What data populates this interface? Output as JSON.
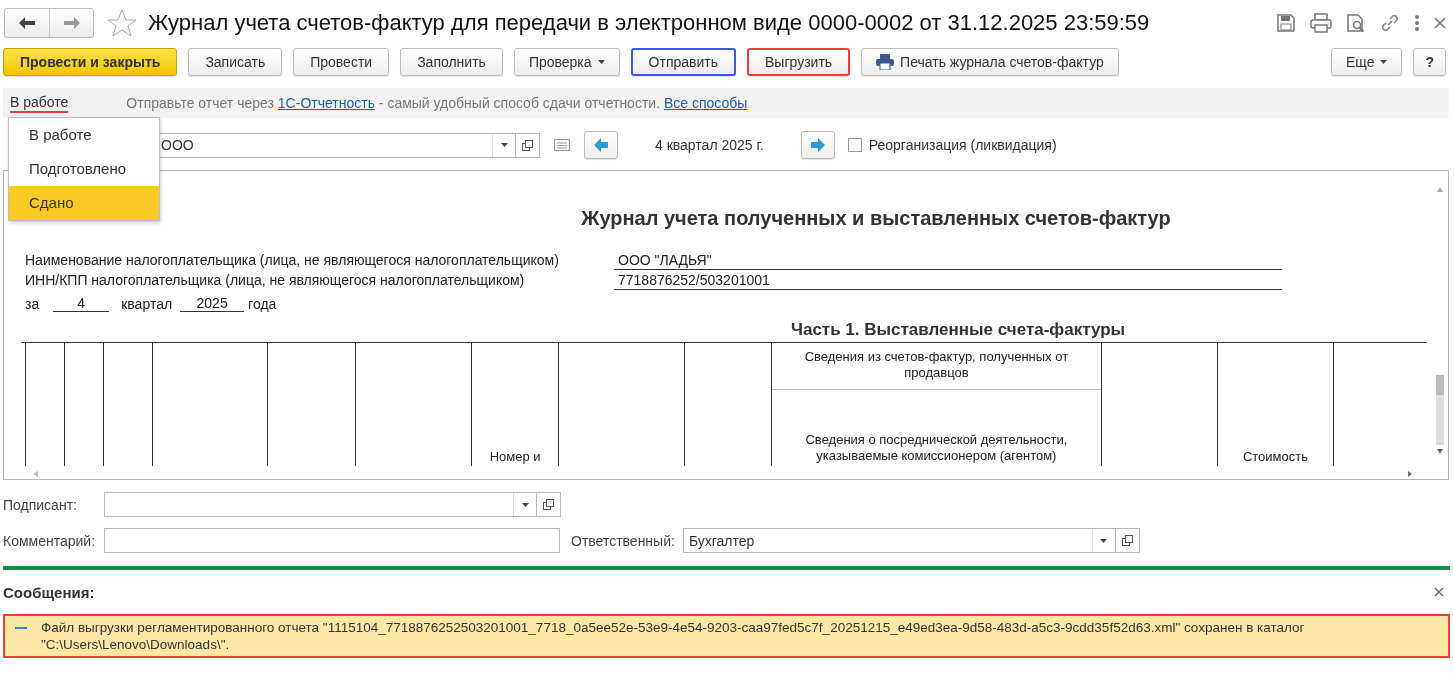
{
  "window": {
    "title": "Журнал учета счетов-фактур для передачи в электронном виде 0000-0002 от 31.12.2025 23:59:59"
  },
  "toolbar": {
    "buttons": [
      {
        "label": "Провести и закрыть",
        "kind": "primary"
      },
      {
        "label": "Записать",
        "kind": "plain"
      },
      {
        "label": "Провести",
        "kind": "plain"
      },
      {
        "label": "Заполнить",
        "kind": "plain"
      },
      {
        "label": "Проверка",
        "kind": "dropdown"
      },
      {
        "label": "Отправить",
        "kind": "plain",
        "color": "#3a55f0"
      },
      {
        "label": "Выгрузить",
        "kind": "plain",
        "color": "#ee3b3b"
      },
      {
        "label": "Печать журнала счетов-фактур",
        "kind": "print"
      },
      {
        "label": "Еще",
        "kind": "dropdown"
      },
      {
        "label": "?",
        "kind": "help"
      }
    ]
  },
  "info_bar": {
    "status": {
      "label": "В работе",
      "color": "#ee3b3b"
    },
    "text_before": "Отправьте отчет через ",
    "link": "1С-Отчетность",
    "text_after": " - самый удобный способ сдачи отчетности.",
    "link_2": "Все способы"
  },
  "status_menu": {
    "items": [
      {
        "label": "В работе",
        "selected": false
      },
      {
        "label": "Подготовлено",
        "selected": false
      },
      {
        "label": "Сдано",
        "selected": true
      }
    ]
  },
  "period_row": {
    "organization": "ООО",
    "period": "4 квартал 2025 г.",
    "reorganization": {
      "label": "Реорганизация (ликвидация)",
      "checked": false
    }
  },
  "report": {
    "title": "Журнал учета полученных и выставленных счетов-фактур",
    "fields": [
      {
        "label": "Наименование налогоплательщика (лица, не являющегося налогоплательщиком)",
        "value": "ООО \"ЛАДЬЯ\""
      },
      {
        "label": "ИНН/КПП налогоплательщика (лица, не являющегося налогоплательщиком)",
        "value": "7718876252/503201001"
      }
    ],
    "period_line": {
      "prefix": "за",
      "quarter": "4",
      "quarter_word": "квартал",
      "year": "2025",
      "suffix": "года"
    },
    "part_title": "Часть 1. Выставленные счета-фактуры",
    "columns": [
      {
        "kind": "plain"
      },
      {
        "kind": "plain"
      },
      {
        "kind": "plain"
      },
      {
        "kind": "plain"
      },
      {
        "kind": "plain"
      },
      {
        "kind": "plain"
      },
      {
        "kind": "plain"
      },
      {
        "kind": "labeled",
        "label": "Номер и"
      },
      {
        "kind": "plain"
      },
      {
        "kind": "plain"
      },
      {
        "kind": "group",
        "header": "Сведения из счетов-фактур, полученных от продавцов",
        "note": "Сведения о посреднической деятельности, указываемые комиссионером (агентом)"
      },
      {
        "kind": "plain"
      },
      {
        "kind": "labeled",
        "label": "Стоимость"
      },
      {
        "kind": "plain"
      }
    ]
  },
  "signer": {
    "label": "Подписант:"
  },
  "comment": {
    "label": "Комментарий:"
  },
  "responsible": {
    "label": "Ответственный:",
    "value": "Бухгалтер"
  },
  "messages": {
    "title": "Сообщения:",
    "items": [
      {
        "text": "Файл выгрузки регламентированного отчета \"1115104_7718876252503201001_7718_0a5ee52e-53e9-4e54-9203-caa97fed5c7f_20251215_e49ed3ea-9d58-483d-a5c3-9cdd35f52d63.xml\" сохранен в каталог \"C:\\Users\\Lenovo\\Downloads\\\".",
        "color": "#ee3b3b"
      }
    ]
  }
}
